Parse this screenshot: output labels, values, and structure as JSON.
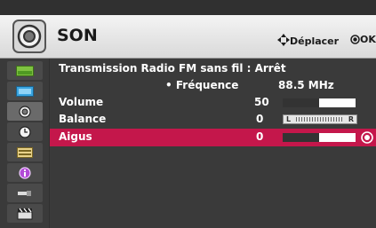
{
  "header": {
    "title": "SON",
    "hint_move": "Déplacer",
    "hint_ok": "OK"
  },
  "rows": {
    "radio": {
      "label": "Transmission Radio FM sans fil : Arrêt"
    },
    "frequency": {
      "label": "• Fréquence",
      "value": "88.5 MHz"
    },
    "volume": {
      "label": "Volume",
      "value": "50",
      "level": 50
    },
    "balance": {
      "label": "Balance",
      "value": "0",
      "left": "L",
      "right": "R"
    },
    "treble": {
      "label": "Aigus",
      "value": "0",
      "level": 50
    }
  },
  "sidebar": {
    "items": [
      {
        "icon": "picture-icon"
      },
      {
        "icon": "screen-icon"
      },
      {
        "icon": "sound-icon"
      },
      {
        "icon": "clock-icon"
      },
      {
        "icon": "options-icon"
      },
      {
        "icon": "info-icon"
      },
      {
        "icon": "input-icon"
      },
      {
        "icon": "media-icon"
      }
    ]
  },
  "colors": {
    "highlight": "#c4174b",
    "header_bg": "#e8e8e8",
    "panel_bg": "#3a3a3a"
  }
}
